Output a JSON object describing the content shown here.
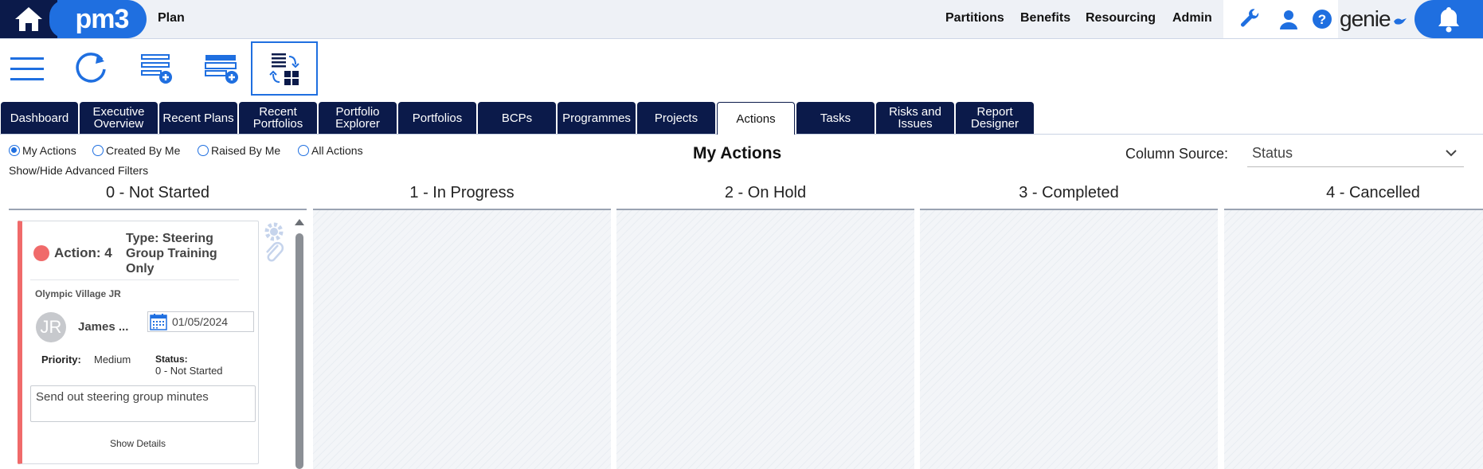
{
  "header": {
    "app_label": "Plan",
    "logo_text": "pm3",
    "brand": "genie",
    "nav": [
      "Partitions",
      "Benefits",
      "Resourcing",
      "Admin"
    ],
    "tool_icons": [
      "wrench-icon",
      "user-icon",
      "help-icon"
    ]
  },
  "toolbar": {
    "icons": [
      "menu-icon",
      "refresh-icon",
      "add-list-icon",
      "add-board-icon",
      "board-view-icon"
    ]
  },
  "tabs": [
    {
      "label": "Dashboard",
      "active": false
    },
    {
      "label": "Executive Overview",
      "active": false
    },
    {
      "label": "Recent Plans",
      "active": false
    },
    {
      "label": "Recent Portfolios",
      "active": false
    },
    {
      "label": "Portfolio Explorer",
      "active": false
    },
    {
      "label": "Portfolios",
      "active": false
    },
    {
      "label": "BCPs",
      "active": false
    },
    {
      "label": "Programmes",
      "active": false
    },
    {
      "label": "Projects",
      "active": false
    },
    {
      "label": "Actions",
      "active": true
    },
    {
      "label": "Tasks",
      "active": false
    },
    {
      "label": "Risks and Issues",
      "active": false
    },
    {
      "label": "Report Designer",
      "active": false
    }
  ],
  "filters": {
    "options": [
      "My Actions",
      "Created By Me",
      "Raised By Me",
      "All Actions"
    ],
    "selected": "My Actions",
    "advanced_link": "Show/Hide Advanced Filters"
  },
  "page_title": "My Actions",
  "column_source": {
    "label": "Column Source:",
    "value": "Status"
  },
  "columns": [
    "0 - Not Started",
    "1 - In Progress",
    "2 - On Hold",
    "3 - Completed",
    "4 - Cancelled"
  ],
  "card": {
    "action": "Action: 4",
    "type": "Type: Steering Group Training Only",
    "project": "Olympic Village JR",
    "avatar_initials": "JR",
    "owner": "James ...",
    "date": "01/05/2024",
    "priority_label": "Priority:",
    "priority_value": "Medium",
    "status_label": "Status:",
    "status_value": "0 - Not Started",
    "description": "Send out steering group minutes",
    "details_link": "Show Details",
    "accent_color": "#f06a6a"
  },
  "colors": {
    "navy": "#0b1a4a",
    "brand_blue": "#1f6fe0"
  }
}
